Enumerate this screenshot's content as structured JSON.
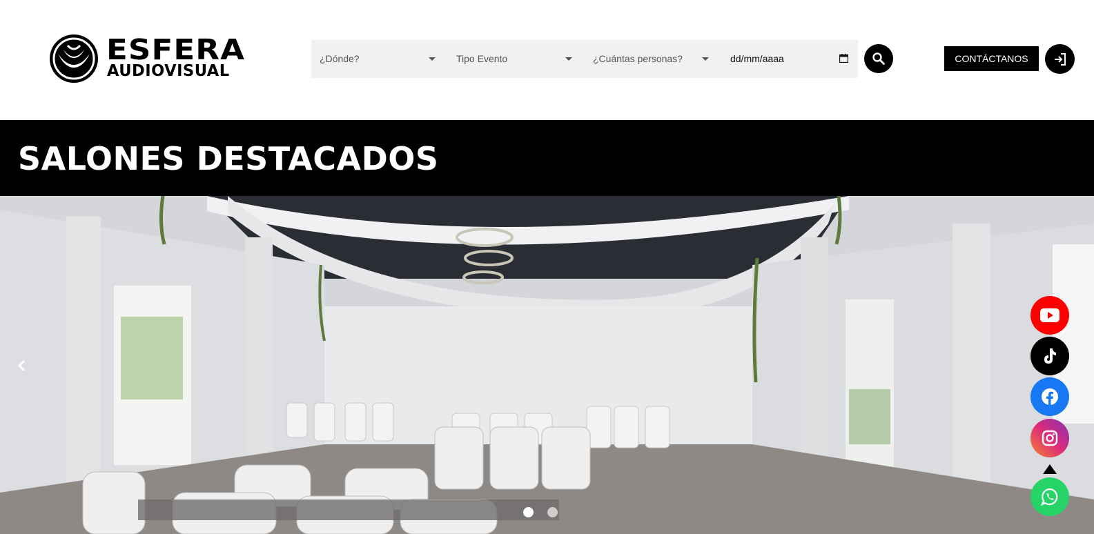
{
  "brand": {
    "name_line1": "ESFERA",
    "name_line2": "AUDIOVISUAL"
  },
  "search": {
    "where_placeholder": "¿Dónde?",
    "event_type_placeholder": "Tipo Evento",
    "guests_placeholder": "¿Cuántas personas?",
    "date_placeholder": "dd/mm/aaaa",
    "search_icon": "search-icon"
  },
  "header": {
    "contact_label": "CONTÁCTANOS",
    "login_icon": "login-icon"
  },
  "banner": {
    "title": "SALONES DESTACADOS"
  },
  "carousel": {
    "slide_count": 2,
    "active_slide": 1
  },
  "social": [
    {
      "name": "youtube",
      "icon": "youtube-icon",
      "color": "#ff0000"
    },
    {
      "name": "tiktok",
      "icon": "tiktok-icon",
      "color": "#000000"
    },
    {
      "name": "facebook",
      "icon": "facebook-icon",
      "color": "#1877f2"
    },
    {
      "name": "instagram",
      "icon": "instagram-icon",
      "color": "#dd2a7b"
    },
    {
      "name": "whatsapp",
      "icon": "whatsapp-icon",
      "color": "#25d366"
    }
  ]
}
